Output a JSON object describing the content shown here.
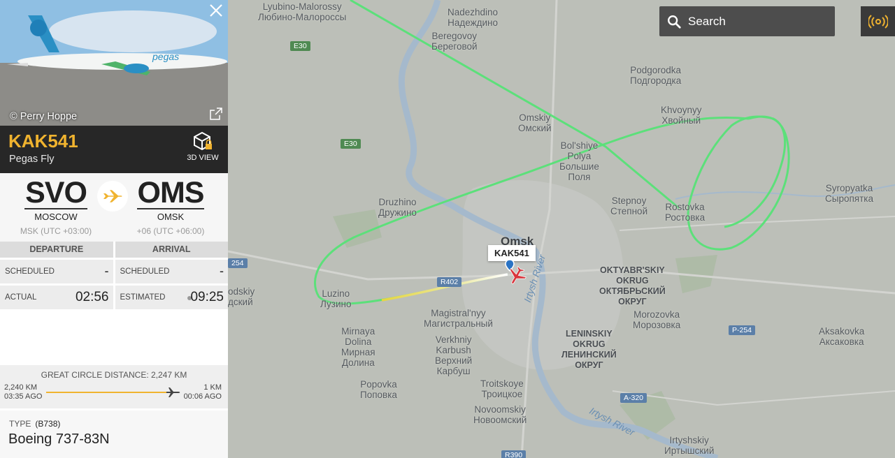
{
  "flight": {
    "callsign": "KAK541",
    "airline": "Pegas Fly",
    "photo_credit": "© Perry Hoppe",
    "view3d_label": "3D VIEW",
    "map_label": "KAK541"
  },
  "origin": {
    "code": "SVO",
    "city": "MOSCOW",
    "tz": "MSK (UTC +03:00)"
  },
  "destination": {
    "code": "OMS",
    "city": "OMSK",
    "tz": "+06 (UTC +06:00)"
  },
  "times": {
    "departure_header": "DEPARTURE",
    "arrival_header": "ARRIVAL",
    "scheduled_label": "SCHEDULED",
    "dep_scheduled": "-",
    "arr_scheduled": "-",
    "actual_label": "ACTUAL",
    "dep_actual": "02:56",
    "estimated_label": "ESTIMATED",
    "arr_estimated": "09:25"
  },
  "distance": {
    "title": "GREAT CIRCLE DISTANCE: 2,247 KM",
    "flown": "2,240 KM",
    "flown_ago": "03:35 AGO",
    "remaining": "1 KM",
    "remaining_ago": "00:06 AGO",
    "progress": 0.997
  },
  "aircraft": {
    "type_label": "TYPE",
    "type_code": "(B738)",
    "model": "Boeing 737-83N"
  },
  "search": {
    "placeholder": "Search"
  },
  "map": {
    "labels": {
      "lyubino": [
        "Lyubino-Malorossy",
        "Любино-Малороссы"
      ],
      "nadezhdino": [
        "Nadezhdino",
        "Надеждино"
      ],
      "beregovoy": [
        "Beregovoy",
        "Береговой"
      ],
      "podgorodka": [
        "Podgorodka",
        "Подгородка"
      ],
      "khvoyny": [
        "Khvoynyy",
        "Хвойный"
      ],
      "omskiy": [
        "Omskiy",
        "Омский"
      ],
      "bolshie": [
        "Bol'shiye",
        "Polya",
        "Большие",
        "Поля"
      ],
      "stepnoy": [
        "Stepnoy",
        "Степной"
      ],
      "rostovka": [
        "Rostovka",
        "Ростовка"
      ],
      "syropyatka": [
        "Syropyatka",
        "Сыропятка"
      ],
      "druzhino": [
        "Druzhino",
        "Дружино"
      ],
      "omsk": "Omsk",
      "oktyabrskiy": [
        "OKTYABR'SKIY",
        "OKRUG",
        "ОКТЯБРЬСКИЙ",
        "ОКРУГ"
      ],
      "luzino": [
        "Luzino",
        "Лузино"
      ],
      "odskiy": [
        "odskiy",
        "дский"
      ],
      "magistralny": [
        "Magistral'nyy",
        "Магистральный"
      ],
      "morozovka": [
        "Morozovka",
        "Морозовка"
      ],
      "mirnaya": [
        "Mirnaya",
        "Dolina",
        "Мирная",
        "Долина"
      ],
      "verkhniy": [
        "Verkhniy",
        "Karbush",
        "Верхний",
        "Карбуш"
      ],
      "leninskiy": [
        "LENINSKIY",
        "OKRUG",
        "ЛЕНИНСКИЙ",
        "ОКРУГ"
      ],
      "aksakovka": [
        "Aksakovka",
        "Аксаковка"
      ],
      "popovka": [
        "Popovka",
        "Поповка"
      ],
      "troitskoye": [
        "Troitskoye",
        "Троицкое"
      ],
      "novoomskiy": [
        "Novoomskiy",
        "Новоомский"
      ],
      "irtyshskiy": [
        "Irtyshskiy",
        "Иртышский"
      ]
    },
    "rivers": {
      "irtysh1": "Irtysh River",
      "irtysh2": "Irtysh River"
    },
    "shields": {
      "e30a": "E30",
      "e30b": "E30",
      "r254": "254",
      "r402": "R402",
      "p254": "P-254",
      "a320": "A-320",
      "r390": "R390"
    },
    "colors": {
      "track_green": "#5ce07a",
      "track_yellow": "#e6d640",
      "plane": "#d9363e"
    }
  }
}
